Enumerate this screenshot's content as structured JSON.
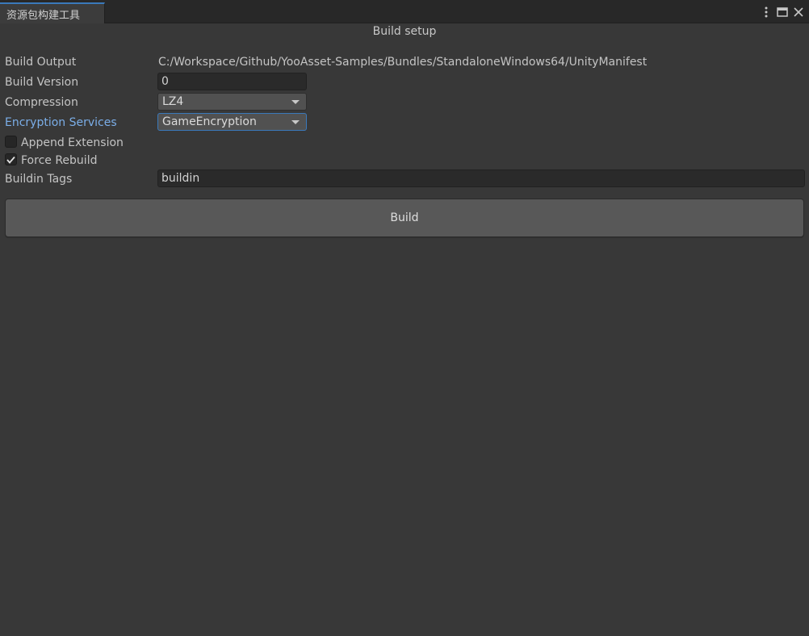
{
  "window": {
    "tab_title": "资源包构建工具",
    "menu_icon": "kebab-menu-icon",
    "maximize_icon": "maximize-icon",
    "close_icon": "close-icon"
  },
  "section": {
    "title": "Build setup"
  },
  "fields": {
    "build_output": {
      "label": "Build Output",
      "value": "C:/Workspace/Github/YooAsset-Samples/Bundles/StandaloneWindows64/UnityManifest"
    },
    "build_version": {
      "label": "Build Version",
      "value": "0"
    },
    "compression": {
      "label": "Compression",
      "selected": "LZ4"
    },
    "encryption_services": {
      "label": "Encryption Services",
      "selected": "GameEncryption"
    },
    "append_extension": {
      "label": "Append Extension",
      "checked": false
    },
    "force_rebuild": {
      "label": "Force Rebuild",
      "checked": true
    },
    "buildin_tags": {
      "label": "Buildin Tags",
      "value": "buildin"
    }
  },
  "actions": {
    "build_label": "Build"
  },
  "colors": {
    "background": "#383838",
    "accent": "#3a79bb",
    "highlight_label": "#7baee8"
  }
}
